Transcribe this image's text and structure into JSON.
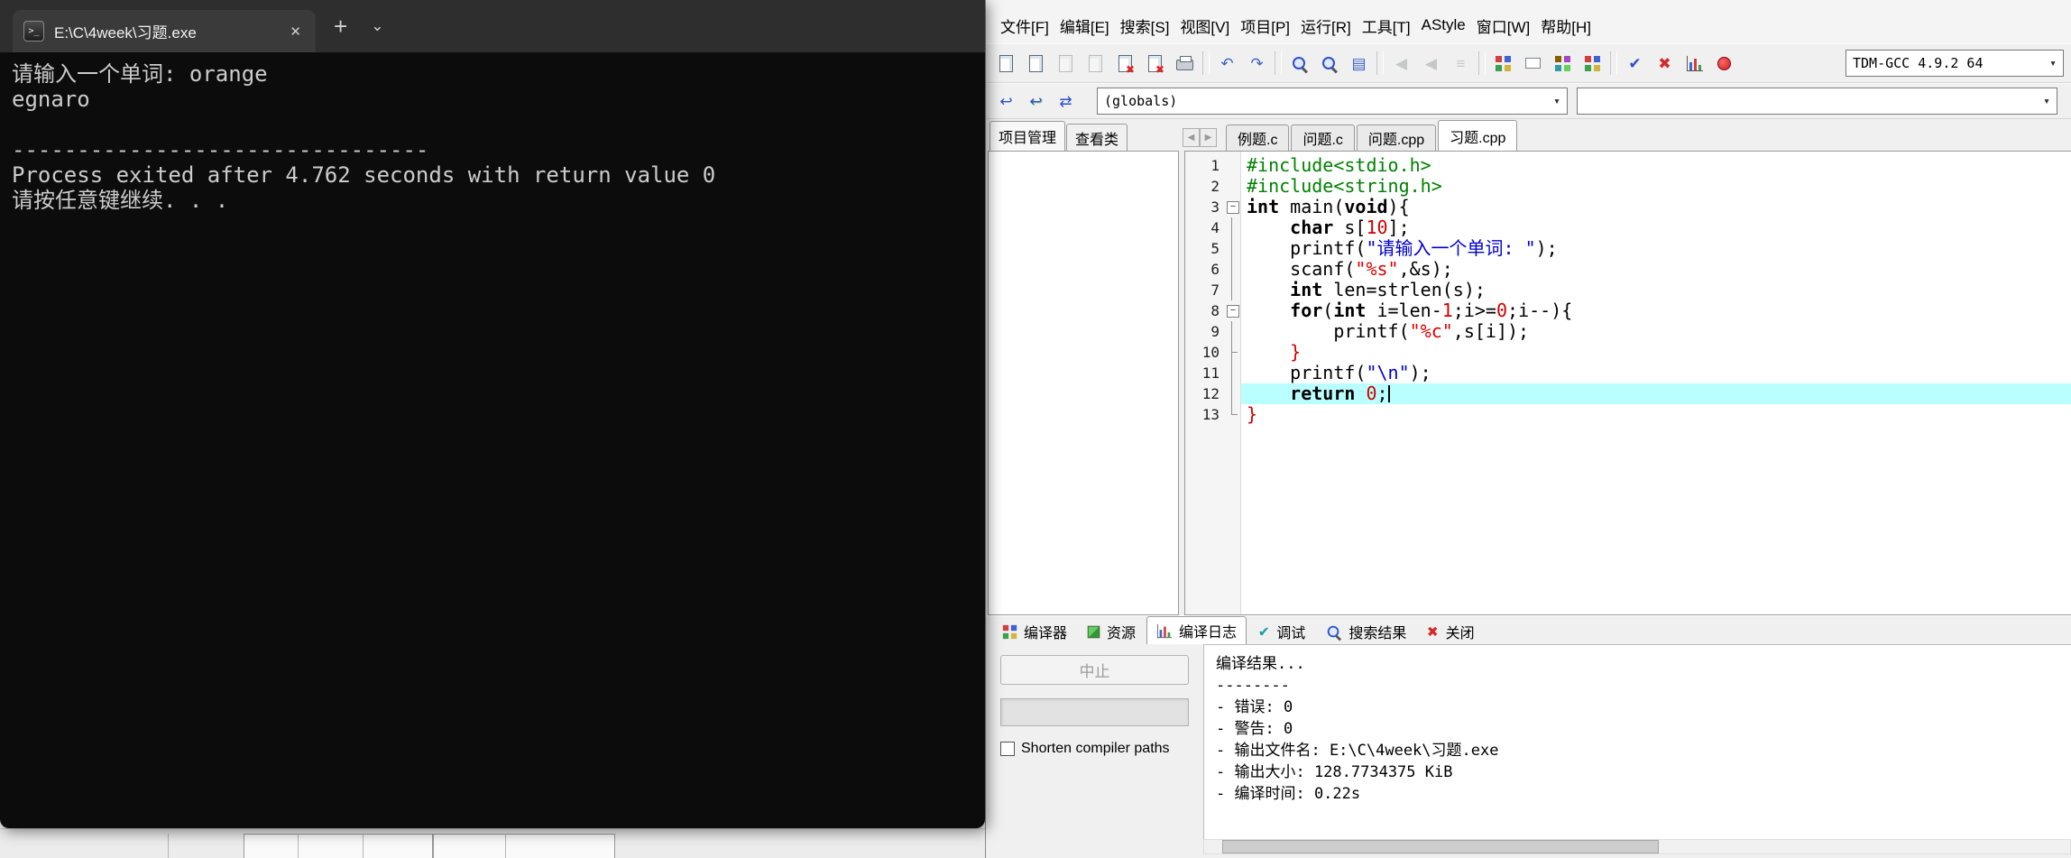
{
  "terminal": {
    "title": "E:\\C\\4week\\习题.exe",
    "icon_glyph": ">_",
    "close_glyph": "✕",
    "new_tab_glyph": "+",
    "dropdown_glyph": "⌄",
    "colors": {
      "bg": "#0c0c0c",
      "titlebar": "#2e2e2e",
      "tab": "#3a3a3a",
      "text": "#cccccc"
    },
    "lines": [
      "请输入一个单词: orange",
      "egnaro",
      "",
      "--------------------------------",
      "Process exited after 4.762 seconds with return value 0",
      "请按任意键继续. . ."
    ]
  },
  "ide": {
    "menu": [
      "文件[F]",
      "编辑[E]",
      "搜索[S]",
      "视图[V]",
      "项目[P]",
      "运行[R]",
      "工具[T]",
      "AStyle",
      "窗口[W]",
      "帮助[H]"
    ],
    "combo_arrow": "▾",
    "tab_scroll_left": "◀",
    "tab_scroll_right": "▶",
    "toolbar_main": [
      {
        "name": "new-source-icon",
        "cls": "ic-page",
        "enabled": true
      },
      {
        "name": "open-file-icon",
        "cls": "ic-page",
        "enabled": true
      },
      {
        "name": "save-icon",
        "cls": "ic-page",
        "enabled": false
      },
      {
        "name": "save-all-icon",
        "cls": "ic-page",
        "enabled": false
      },
      {
        "name": "close-file-icon",
        "cls": "ic-page ic-page-x",
        "enabled": true
      },
      {
        "name": "close-all-icon",
        "cls": "ic-page ic-page-x",
        "enabled": true
      },
      {
        "name": "print-icon",
        "cls": "ic-print",
        "enabled": true
      },
      {
        "sep": true
      },
      {
        "name": "undo-icon",
        "glyph": "↶",
        "color": "#3b63c4",
        "enabled": true
      },
      {
        "name": "redo-icon",
        "glyph": "↷",
        "color": "#3b63c4",
        "enabled": true
      },
      {
        "sep": true
      },
      {
        "name": "find-icon",
        "cls": "ic-mag",
        "enabled": true
      },
      {
        "name": "replace-icon",
        "cls": "ic-mag",
        "enabled": true
      },
      {
        "name": "find-in-files-icon",
        "glyph": "▤",
        "color": "#3b63c4",
        "enabled": true
      },
      {
        "sep": true
      },
      {
        "name": "back-icon",
        "glyph": "◀",
        "color": "#4a9a8a",
        "enabled": false
      },
      {
        "name": "forward-icon",
        "glyph": "◀",
        "color": "#4a9a8a",
        "enabled": false
      },
      {
        "name": "history-list-icon",
        "glyph": "≡",
        "color": "#7a94a8",
        "enabled": false
      },
      {
        "sep": true
      },
      {
        "name": "new-project-icon",
        "cls": "ic-grid4",
        "enabled": true
      },
      {
        "name": "remove-from-project-icon",
        "cls": "ic-rect",
        "enabled": true
      },
      {
        "name": "add-to-project-icon",
        "cls": "ic-grid4 ic-grid-green",
        "enabled": true
      },
      {
        "name": "project-options-icon",
        "cls": "ic-grid4",
        "enabled": true
      },
      {
        "sep": true
      },
      {
        "name": "compile-icon",
        "glyph": "✔",
        "color": "#2b50c8",
        "enabled": true
      },
      {
        "name": "rebuild-icon",
        "glyph": "✖",
        "color": "#d42a2a",
        "enabled": true
      },
      {
        "name": "profile-icon",
        "cls": "ic-chart",
        "enabled": true
      },
      {
        "name": "debug-icon",
        "cls": "ic-bug",
        "enabled": true
      }
    ],
    "compiler_combo": "TDM-GCC 4.9.2 64",
    "toolbar_nav": [
      {
        "name": "goto-declaration-icon",
        "glyph": "↩",
        "color": "#2b50c8",
        "cls": "ic-door",
        "enabled": true
      },
      {
        "name": "goto-definition-icon",
        "glyph": "↩",
        "color": "#2b50c8",
        "cls": "ic-door ic-door-green",
        "enabled": true
      },
      {
        "name": "swap-header-source-icon",
        "glyph": "⇄",
        "color": "#2b50c8",
        "cls": "ic-door",
        "enabled": true
      }
    ],
    "globals_combo": "(globals)",
    "class_combo": "",
    "left_tabs": [
      {
        "label": "项目管理",
        "active": true
      },
      {
        "label": "查看类",
        "active": false
      }
    ],
    "editor_tabs": [
      {
        "label": "例题.c",
        "active": false
      },
      {
        "label": "问题.c",
        "active": false
      },
      {
        "label": "问题.cpp",
        "active": false
      },
      {
        "label": "习题.cpp",
        "active": true
      }
    ],
    "editor": {
      "current_line": 12,
      "colors": {
        "current_line_bg": "#baffff",
        "preprocessor": "#008000",
        "string": "#e00000",
        "wide_string": "#0000d0",
        "number": "#d00000"
      },
      "lines": [
        {
          "num": 1,
          "fold": "",
          "segs": [
            {
              "c": "pp",
              "t": "#include<stdio.h>"
            }
          ]
        },
        {
          "num": 2,
          "fold": "",
          "segs": [
            {
              "c": "pp",
              "t": "#include<string.h>"
            }
          ]
        },
        {
          "num": 3,
          "fold": "box",
          "segs": [
            {
              "c": "k",
              "t": "int"
            },
            {
              "t": " main("
            },
            {
              "c": "k",
              "t": "void"
            },
            {
              "t": "){"
            }
          ]
        },
        {
          "num": 4,
          "fold": "line",
          "segs": [
            {
              "t": "    "
            },
            {
              "c": "k",
              "t": "char"
            },
            {
              "t": " s["
            },
            {
              "c": "n",
              "t": "10"
            },
            {
              "t": "];"
            }
          ]
        },
        {
          "num": 5,
          "fold": "line",
          "segs": [
            {
              "t": "    printf("
            },
            {
              "c": "e",
              "t": "\"请输入一个单词: \""
            },
            {
              "t": ");"
            }
          ]
        },
        {
          "num": 6,
          "fold": "line",
          "segs": [
            {
              "t": "    scanf("
            },
            {
              "c": "s",
              "t": "\"%s\""
            },
            {
              "t": ",&s);"
            }
          ]
        },
        {
          "num": 7,
          "fold": "line",
          "segs": [
            {
              "t": "    "
            },
            {
              "c": "k",
              "t": "int"
            },
            {
              "t": " len=strlen(s);"
            }
          ]
        },
        {
          "num": 8,
          "fold": "box",
          "segs": [
            {
              "t": "    "
            },
            {
              "c": "k",
              "t": "for"
            },
            {
              "t": "("
            },
            {
              "c": "k",
              "t": "int"
            },
            {
              "t": " i=len-"
            },
            {
              "c": "n",
              "t": "1"
            },
            {
              "t": ";i>="
            },
            {
              "c": "n",
              "t": "0"
            },
            {
              "t": ";i--){"
            }
          ]
        },
        {
          "num": 9,
          "fold": "line",
          "segs": [
            {
              "t": "        printf("
            },
            {
              "c": "s",
              "t": "\"%c\""
            },
            {
              "t": ",s[i]);"
            }
          ]
        },
        {
          "num": 10,
          "fold": "tee",
          "segs": [
            {
              "t": "    "
            },
            {
              "c": "n",
              "t": "}"
            }
          ]
        },
        {
          "num": 11,
          "fold": "line",
          "segs": [
            {
              "t": "    printf("
            },
            {
              "c": "e",
              "t": "\"\\n\""
            },
            {
              "t": ");"
            }
          ]
        },
        {
          "num": 12,
          "fold": "line",
          "segs": [
            {
              "t": "    "
            },
            {
              "c": "k",
              "t": "return"
            },
            {
              "t": " "
            },
            {
              "c": "n",
              "t": "0"
            },
            {
              "t": ";"
            }
          ]
        },
        {
          "num": 13,
          "fold": "end",
          "segs": [
            {
              "c": "n",
              "t": "}"
            }
          ]
        }
      ]
    },
    "bottom_tabs": [
      {
        "label": "编译器",
        "icon_name": "compiler-tab-icon",
        "icon_cls": "ic-grid4",
        "active": false
      },
      {
        "label": "资源",
        "icon_name": "resources-tab-icon",
        "icon_cls": "ic-res",
        "active": false
      },
      {
        "label": "编译日志",
        "icon_name": "compile-log-tab-icon",
        "icon_cls": "ic-chart",
        "active": true
      },
      {
        "label": "调试",
        "icon_name": "debug-tab-icon",
        "glyph": "✔",
        "color": "#18a0a0",
        "active": false
      },
      {
        "label": "搜索结果",
        "icon_name": "search-results-tab-icon",
        "icon_cls": "ic-mag",
        "active": false
      },
      {
        "label": "关闭",
        "icon_name": "close-panel-tab-icon",
        "glyph": "✖",
        "color": "#d42a2a",
        "active": false
      }
    ],
    "compile_log": {
      "abort_label": "中止",
      "shorten_label": "Shorten compiler paths",
      "lines": [
        "编译结果...",
        "--------",
        "- 错误: 0",
        "- 警告: 0",
        "- 输出文件名: E:\\C\\4week\\习题.exe",
        "- 输出大小: 128.7734375 KiB",
        "- 编译时间: 0.22s"
      ]
    }
  }
}
